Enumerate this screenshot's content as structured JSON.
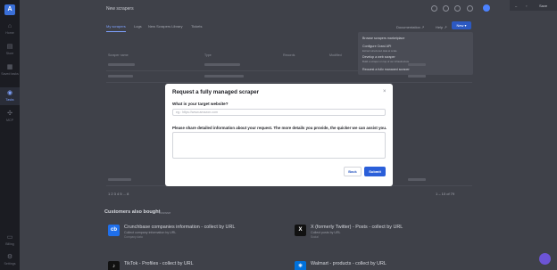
{
  "sidebar": {
    "logo": "A",
    "items": [
      {
        "label": "Home",
        "icon": "home-icon",
        "glyph": "⌂"
      },
      {
        "label": "Store",
        "icon": "store-icon",
        "glyph": "▤"
      },
      {
        "label": "Saved tasks",
        "icon": "tasks-icon",
        "glyph": "▦"
      },
      {
        "label": "Tasks",
        "icon": "runs-icon",
        "glyph": "◉"
      },
      {
        "label": "MCP",
        "icon": "mcp-icon",
        "glyph": "✣"
      },
      {
        "label": "Billing",
        "icon": "billing-icon",
        "glyph": "▭"
      },
      {
        "label": "Settings",
        "icon": "settings-icon",
        "glyph": "⚙"
      }
    ]
  },
  "header": {
    "title": "New scrapers",
    "window_label": "Save"
  },
  "tabs": [
    "My scrapers",
    "Logs",
    "New Scrapers Library",
    "Tickets"
  ],
  "header_actions": {
    "documentation": "Documentation ↗",
    "help": "Help ↗",
    "new_button": "New ▾"
  },
  "dropdown": [
    {
      "title": "Browse scrapers marketplace",
      "sub": ""
    },
    {
      "title": "Configure Crawl API",
      "sub": "Extract structured data at scale"
    },
    {
      "title": "Develop a web scraper",
      "sub": "Build a scraper on top of our infrastructure"
    },
    {
      "title": "Request a fully managed scraper",
      "sub": ""
    }
  ],
  "table": {
    "headers": [
      "Scraper name",
      "Type",
      "Records",
      "Modified"
    ]
  },
  "pagination": {
    "pages": "1  2  3  4  5  ...  8",
    "range": "1 – 10 of 79"
  },
  "also_bought": {
    "title": "Customers also bought",
    "subtitle": "Browse",
    "cards": [
      {
        "logo": "cb",
        "logo_color": "#1f6feb",
        "title": "Crunchbase companies information - collect by URL",
        "desc": "Collect company information by URL",
        "meta": "Company data"
      },
      {
        "logo": "X",
        "logo_color": "#111111",
        "title": "X (formerly Twitter) - Posts - collect by URL",
        "desc": "Collect posts by URL",
        "meta": "Social"
      },
      {
        "logo": "♪",
        "logo_color": "#111111",
        "title": "TikTok - Profiles - collect by URL",
        "desc": "",
        "meta": ""
      },
      {
        "logo": "✳",
        "logo_color": "#0071dc",
        "title": "Walmart - products - collect by URL",
        "desc": "",
        "meta": ""
      }
    ]
  },
  "modal": {
    "title": "Request a fully managed scraper",
    "close": "×",
    "url_label": "What is your target website?",
    "url_placeholder": "eg.: https://www.amazon.com",
    "details_label": "Please share detailed information about your request. The more details you provide, the quicker we can assist you.",
    "back": "Back",
    "submit": "Submit"
  },
  "colors": {
    "accent": "#2b5fd9",
    "backdrop": "#3f4149"
  }
}
